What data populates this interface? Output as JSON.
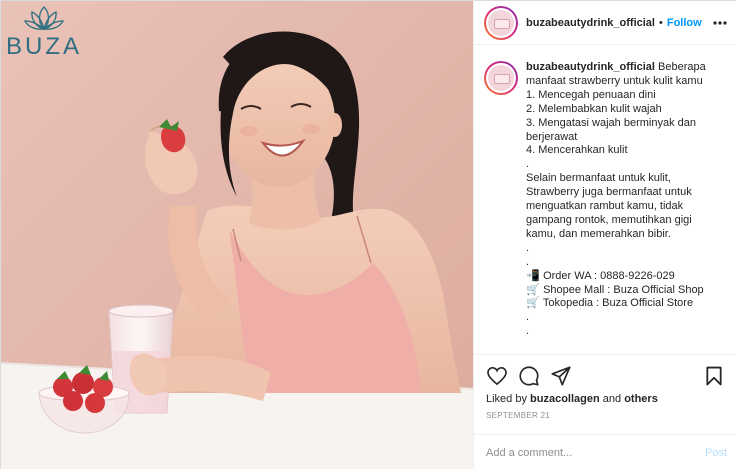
{
  "photo": {
    "brand_name": "BUZA",
    "brand_icon": "lotus-logo",
    "colors": {
      "background": "#e6b9ad",
      "brand": "#2f6f80",
      "dress": "#efaea8",
      "table": "#f6f3f1"
    }
  },
  "post": {
    "username": "buzabeautydrink_official",
    "follow_label": "Follow",
    "more_icon": "more-options-icon",
    "caption": {
      "username": "buzabeautydrink_official",
      "intro": " Beberapa",
      "lines": [
        "manfaat strawberry untuk kulit kamu",
        "1. Mencegah penuaan dini",
        "2. Melembabkan kulit wajah",
        "3. Mengatasi wajah berminyak dan",
        "berjerawat",
        "4. Mencerahkan kulit",
        ".",
        "Selain bermanfaat untuk kulit,",
        "Strawberry juga bermanfaat untuk",
        "menguatkan rambut kamu, tidak",
        "gampang rontok, memutihkan gigi",
        "kamu, dan memerahkan bibir.",
        ".",
        "."
      ],
      "contacts": [
        {
          "emoji": "📲",
          "text": "Order WA : 0888-9226-029"
        },
        {
          "emoji": "🛒",
          "text": "Shopee Mall : Buza Official Shop"
        },
        {
          "emoji": "🛒",
          "text": "Tokopedia : Buza Official Store"
        }
      ],
      "trailing": [
        ".",
        "."
      ]
    },
    "actions": {
      "like_icon": "heart-icon",
      "comment_icon": "comment-icon",
      "share_icon": "share-icon",
      "save_icon": "bookmark-icon"
    },
    "likes": {
      "prefix": "Liked by ",
      "user": "buzacollagen",
      "suffix": " and ",
      "others": "others"
    },
    "date": "SEPTEMBER 21",
    "comment": {
      "placeholder": "Add a comment...",
      "post_label": "Post"
    },
    "colors": {
      "link": "#0095f6",
      "muted": "#8e8e8e",
      "post_disabled": "#b2dffc"
    }
  }
}
